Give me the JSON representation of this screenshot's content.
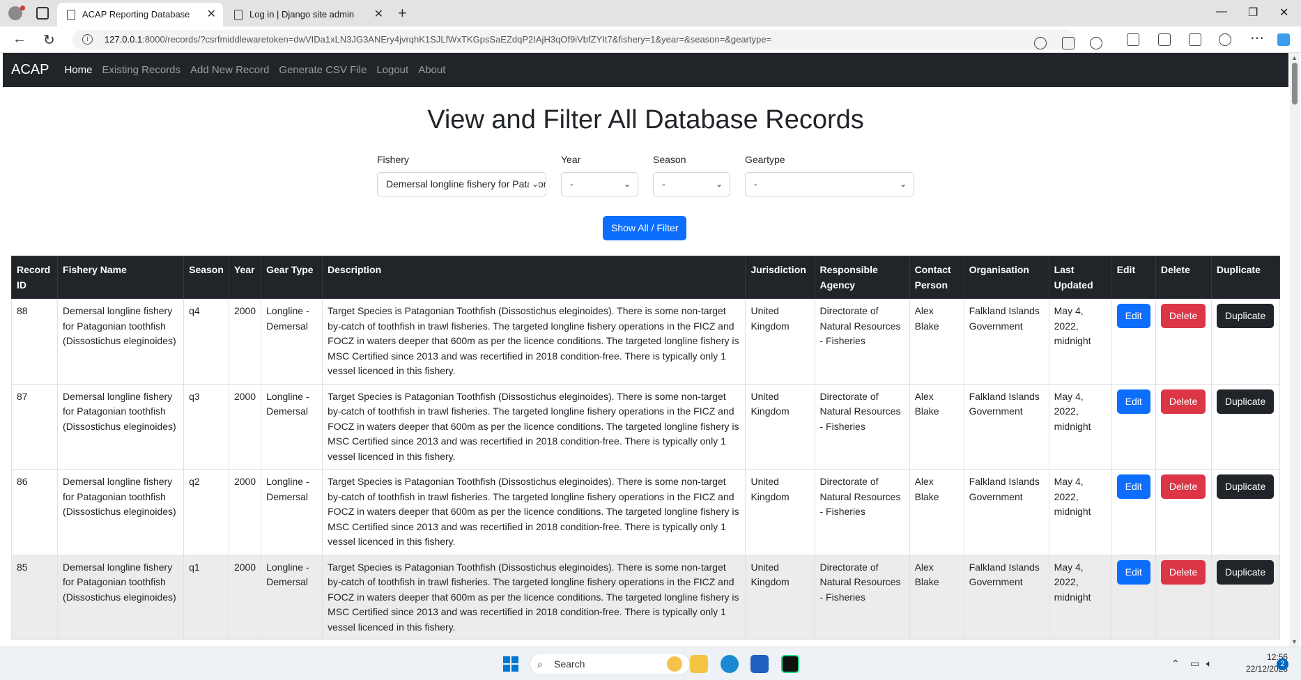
{
  "browser": {
    "tabs": [
      {
        "title": "ACAP Reporting Database",
        "active": true
      },
      {
        "title": "Log in | Django site admin",
        "active": false
      }
    ],
    "url_host": "127.0.0.1",
    "url_rest": ":8000/records/?csrfmiddlewaretoken=dwVIDa1xLN3JG3ANEry4jvrqhK1SJLfWxTKGpsSaEZdqP2IAjH3qOf9iVbfZYIt7&fishery=1&year=&season=&geartype="
  },
  "nav": {
    "brand": "ACAP",
    "links": [
      "Home",
      "Existing Records",
      "Add New Record",
      "Generate CSV File",
      "Logout",
      "About"
    ]
  },
  "page_title": "View and Filter All Database Records",
  "filters": {
    "fishery": {
      "label": "Fishery",
      "value": "Demersal longline fishery for Patagonian toothfish (Dissostichus eleginoides)"
    },
    "year": {
      "label": "Year",
      "value": "-"
    },
    "season": {
      "label": "Season",
      "value": "-"
    },
    "geartype": {
      "label": "Geartype",
      "value": "-"
    },
    "button": "Show All / Filter"
  },
  "table": {
    "headers": [
      "Record ID",
      "Fishery Name",
      "Season",
      "Year",
      "Gear Type",
      "Description",
      "Jurisdiction",
      "Responsible Agency",
      "Contact Person",
      "Organisation",
      "Last Updated",
      "Edit",
      "Delete",
      "Duplicate"
    ],
    "button_labels": {
      "edit": "Edit",
      "delete": "Delete",
      "duplicate": "Duplicate"
    },
    "rows": [
      {
        "id": "88",
        "fishery": "Demersal longline fishery for Patagonian toothfish (Dissostichus eleginoides)",
        "season": "q4",
        "year": "2000",
        "gear": "Longline - Demersal",
        "description": "Target Species is Patagonian Toothfish (Dissostichus eleginoides). There is some non-target by-catch of toothfish in trawl fisheries. The targeted longline fishery operations in the FICZ and FOCZ in waters deeper that 600m as per the licence conditions. The targeted longline fishery is MSC Certified since 2013 and was recertified in 2018 condition-free. There is typically only 1 vessel licenced in this fishery.",
        "jurisdiction": "United Kingdom",
        "agency": "Directorate of Natural Resources - Fisheries",
        "contact": "Alex Blake",
        "organisation": "Falkland Islands Government",
        "updated": "May 4, 2022, midnight"
      },
      {
        "id": "87",
        "fishery": "Demersal longline fishery for Patagonian toothfish (Dissostichus eleginoides)",
        "season": "q3",
        "year": "2000",
        "gear": "Longline - Demersal",
        "description": "Target Species is Patagonian Toothfish (Dissostichus eleginoides). There is some non-target by-catch of toothfish in trawl fisheries. The targeted longline fishery operations in the FICZ and FOCZ in waters deeper that 600m as per the licence conditions. The targeted longline fishery is MSC Certified since 2013 and was recertified in 2018 condition-free. There is typically only 1 vessel licenced in this fishery.",
        "jurisdiction": "United Kingdom",
        "agency": "Directorate of Natural Resources - Fisheries",
        "contact": "Alex Blake",
        "organisation": "Falkland Islands Government",
        "updated": "May 4, 2022, midnight"
      },
      {
        "id": "86",
        "fishery": "Demersal longline fishery for Patagonian toothfish (Dissostichus eleginoides)",
        "season": "q2",
        "year": "2000",
        "gear": "Longline - Demersal",
        "description": "Target Species is Patagonian Toothfish (Dissostichus eleginoides). There is some non-target by-catch of toothfish in trawl fisheries. The targeted longline fishery operations in the FICZ and FOCZ in waters deeper that 600m as per the licence conditions. The targeted longline fishery is MSC Certified since 2013 and was recertified in 2018 condition-free. There is typically only 1 vessel licenced in this fishery.",
        "jurisdiction": "United Kingdom",
        "agency": "Directorate of Natural Resources - Fisheries",
        "contact": "Alex Blake",
        "organisation": "Falkland Islands Government",
        "updated": "May 4, 2022, midnight"
      },
      {
        "id": "85",
        "fishery": "Demersal longline fishery for Patagonian toothfish (Dissostichus eleginoides)",
        "season": "q1",
        "year": "2000",
        "gear": "Longline - Demersal",
        "description": "Target Species is Patagonian Toothfish (Dissostichus eleginoides). There is some non-target by-catch of toothfish in trawl fisheries. The targeted longline fishery operations in the FICZ and FOCZ in waters deeper that 600m as per the licence conditions. The targeted longline fishery is MSC Certified since 2013 and was recertified in 2018 condition-free. There is typically only 1 vessel licenced in this fishery.",
        "jurisdiction": "United Kingdom",
        "agency": "Directorate of Natural Resources - Fisheries",
        "contact": "Alex Blake",
        "organisation": "Falkland Islands Government",
        "updated": "May 4, 2022, midnight"
      }
    ]
  },
  "taskbar": {
    "search_placeholder": "Search",
    "time": "12:56",
    "date": "22/12/2023",
    "notifications": "2"
  },
  "colors": {
    "navbar": "#212529",
    "primary": "#0d6efd",
    "danger": "#dc3545",
    "dark": "#212529"
  }
}
